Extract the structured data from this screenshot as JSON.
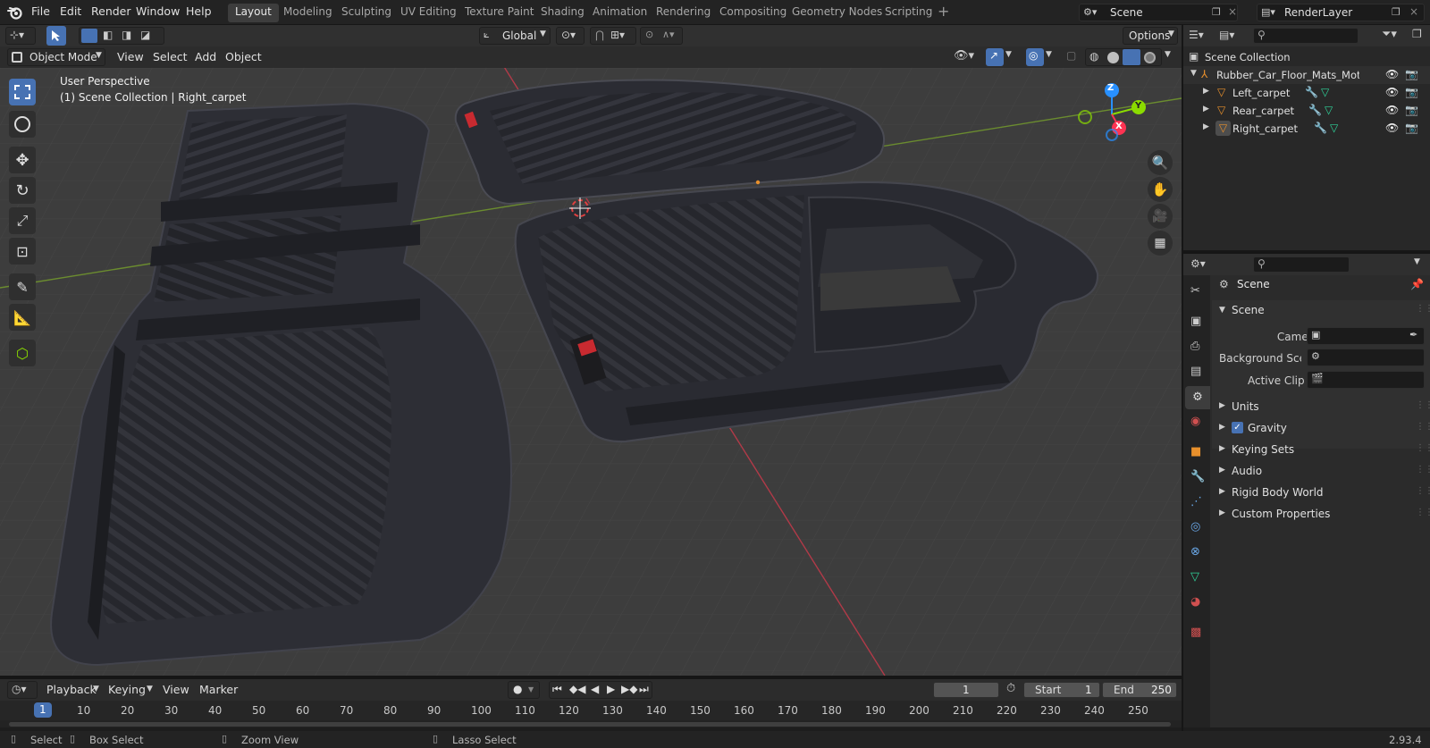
{
  "topbar": {
    "menus": [
      "File",
      "Edit",
      "Render",
      "Window",
      "Help"
    ],
    "workspaces": [
      "Layout",
      "Modeling",
      "Sculpting",
      "UV Editing",
      "Texture Paint",
      "Shading",
      "Animation",
      "Rendering",
      "Compositing",
      "Geometry Nodes",
      "Scripting"
    ],
    "active_workspace": "Layout",
    "scene": "Scene",
    "view_layer": "RenderLayer"
  },
  "viewport_header": {
    "transform_orientation": "Global",
    "options": "Options",
    "mode": "Object Mode",
    "menus": [
      "View",
      "Select",
      "Add",
      "Object"
    ]
  },
  "viewport": {
    "perspective": "User Perspective",
    "context": "(1) Scene Collection | Right_carpet",
    "axes": {
      "z": "Z",
      "y": "Y",
      "x": "X"
    }
  },
  "outliner": {
    "root": "Scene Collection",
    "collection": "Rubber_Car_Floor_Mats_Motc",
    "objects": [
      "Left_carpet",
      "Rear_carpet",
      "Right_carpet"
    ]
  },
  "properties": {
    "title": "Scene",
    "section": "Scene",
    "fields": [
      {
        "label": "Camera"
      },
      {
        "label": "Background Sce..."
      },
      {
        "label": "Active Clip"
      }
    ],
    "panels": [
      "Units",
      "Gravity",
      "Keying Sets",
      "Audio",
      "Rigid Body World",
      "Custom Properties"
    ],
    "gravity_checked": true
  },
  "timeline": {
    "menus": [
      "Playback",
      "Keying",
      "View",
      "Marker"
    ],
    "current_frame": "1",
    "start_label": "Start",
    "start": "1",
    "end_label": "End",
    "end": "250",
    "ruler": [
      "10",
      "20",
      "30",
      "40",
      "50",
      "60",
      "70",
      "80",
      "90",
      "100",
      "110",
      "120",
      "130",
      "140",
      "150",
      "160",
      "170",
      "180",
      "190",
      "200",
      "210",
      "220",
      "230",
      "240",
      "250"
    ],
    "playhead": "1"
  },
  "statusbar": {
    "items": [
      "Select",
      "Box Select",
      "Zoom View",
      "Lasso Select"
    ],
    "version": "2.93.4"
  },
  "colors": {
    "accent": "#4772b3",
    "axis_x": "#ff3352",
    "axis_y": "#8bdc00",
    "axis_z": "#2890ff",
    "object_orange": "#e8902c",
    "mesh_green": "#2fd39a"
  }
}
